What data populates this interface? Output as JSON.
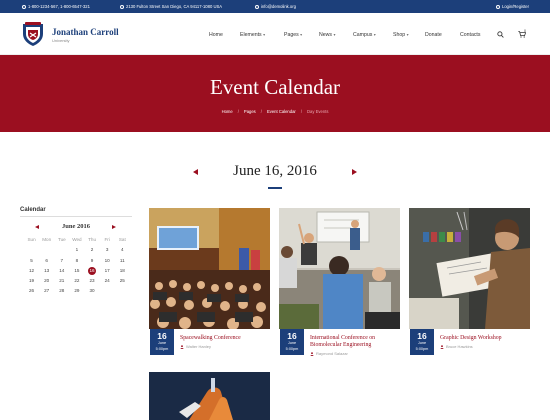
{
  "topbar": {
    "phones": "1-800-1234-567, 1-800-6547-321",
    "address": "2130 Fulton Street San Diego, CA 94117-1080 USA",
    "email": "info@demolink.org",
    "login": "Login/Register"
  },
  "brand": {
    "name": "Jonathan Carroll",
    "subtitle": "University"
  },
  "nav": [
    {
      "label": "Home"
    },
    {
      "label": "Elements"
    },
    {
      "label": "Pages"
    },
    {
      "label": "News"
    },
    {
      "label": "Campus"
    },
    {
      "label": "Shop"
    },
    {
      "label": "Donate"
    },
    {
      "label": "Contacts"
    }
  ],
  "cart": {
    "count": "0"
  },
  "hero": {
    "title": "Event Calendar",
    "breadcrumbs": [
      "Home",
      "Pages",
      "Event Calendar",
      "Day Events"
    ]
  },
  "date_nav": {
    "title": "June 16, 2016"
  },
  "calendar": {
    "title": "Calendar",
    "month": "June 2016",
    "weekdays": [
      "Sun",
      "Mon",
      "Tue",
      "Wed",
      "Thu",
      "Fri",
      "Sat"
    ],
    "weeks": [
      [
        "",
        "",
        "",
        "1",
        "2",
        "3",
        "4"
      ],
      [
        "5",
        "6",
        "7",
        "8",
        "9",
        "10",
        "11"
      ],
      [
        "12",
        "13",
        "14",
        "15",
        "16",
        "17",
        "18"
      ],
      [
        "19",
        "20",
        "21",
        "22",
        "23",
        "24",
        "25"
      ],
      [
        "26",
        "27",
        "28",
        "29",
        "30",
        "",
        ""
      ]
    ],
    "selected": "16"
  },
  "events": [
    {
      "day": "16",
      "month": "June",
      "time": "5:00pm",
      "title": "Spacewalking Conference",
      "author": "Walter Hanley"
    },
    {
      "day": "16",
      "month": "June",
      "time": "5:00pm",
      "title": "International Conference on Biomolecular Engineering",
      "author": "Raymond Salazar"
    },
    {
      "day": "16",
      "month": "June",
      "time": "5:00pm",
      "title": "Graphic Design Workshop",
      "author": "Bruce Hawkins"
    }
  ],
  "colors": {
    "brand_navy": "#1c3f7a",
    "brand_red": "#9b0f20"
  }
}
